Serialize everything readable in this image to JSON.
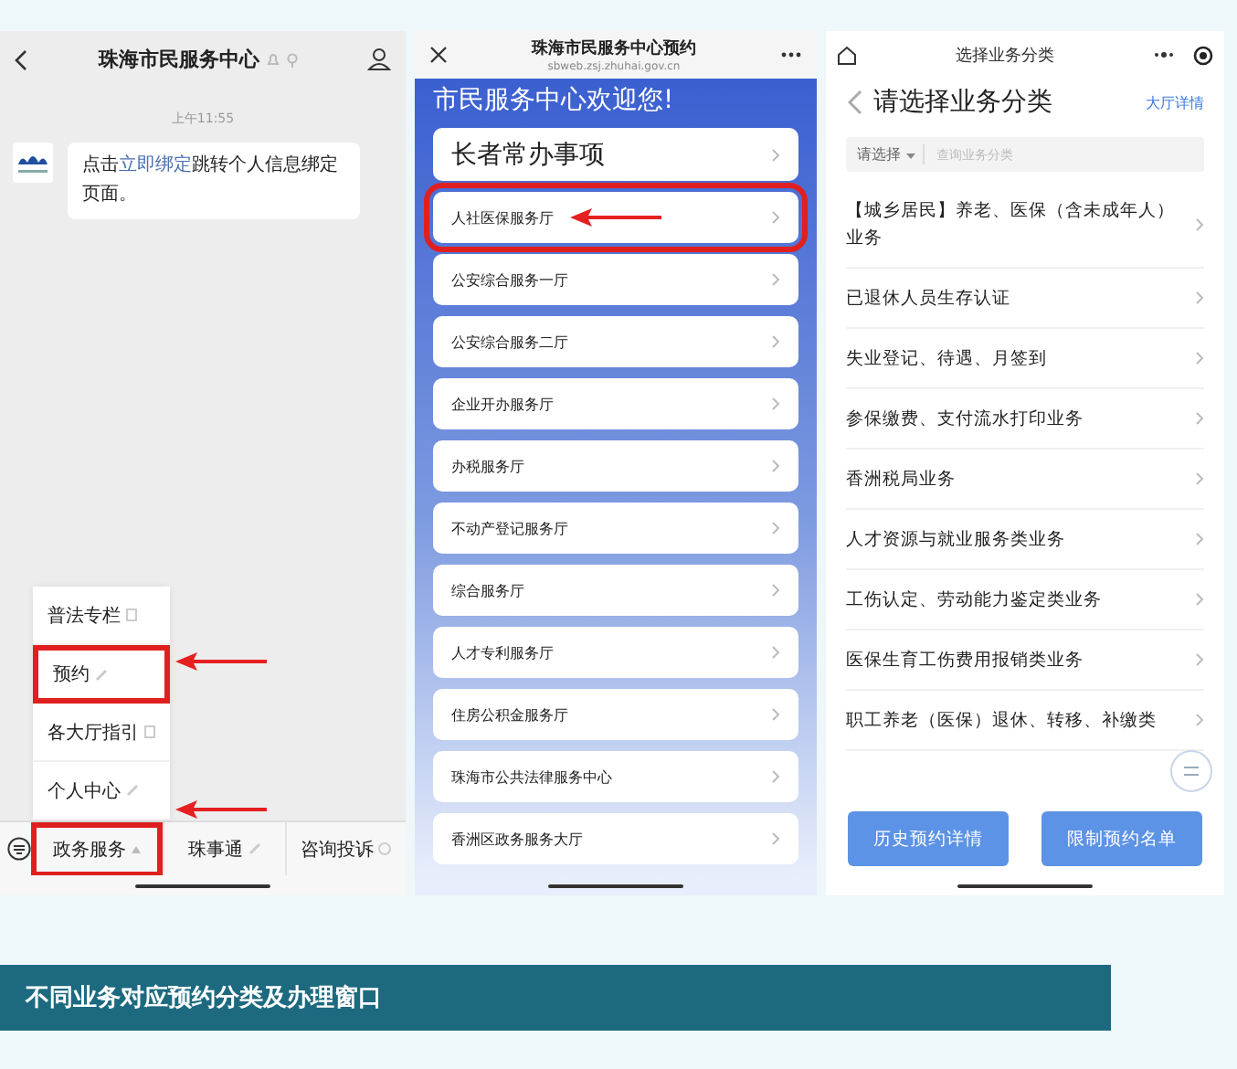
{
  "chat_screen": {
    "title": "珠海市民服务中心",
    "timestamp": "上午11:55",
    "message": {
      "text_before": "点击",
      "link": "立即绑定",
      "text_after": "跳转个人信息绑定页面。"
    },
    "menu": [
      {
        "label": "普法专栏",
        "kind": "page",
        "highlighted": false
      },
      {
        "label": "预约",
        "kind": "link",
        "highlighted": true
      },
      {
        "label": "各大厅指引",
        "kind": "page",
        "highlighted": false
      },
      {
        "label": "个人中心",
        "kind": "link",
        "highlighted": false
      }
    ],
    "bottom_tabs": [
      {
        "label": "政务服务",
        "kind": "menu",
        "highlighted": true
      },
      {
        "label": "珠事通",
        "kind": "link",
        "highlighted": false
      },
      {
        "label": "咨询投诉",
        "kind": "mini",
        "highlighted": false
      }
    ]
  },
  "booking_screen": {
    "title": "珠海市民服务中心预约",
    "url": "sbweb.zsj.zhuhai.gov.cn",
    "welcome": "市民服务中心欢迎您!",
    "halls": [
      {
        "label": "长者常办事项",
        "kind": "large",
        "highlighted": false
      },
      {
        "label": "人社医保服务厅",
        "kind": "normal",
        "highlighted": true
      },
      {
        "label": "公安综合服务一厅",
        "kind": "normal",
        "highlighted": false
      },
      {
        "label": "公安综合服务二厅",
        "kind": "normal",
        "highlighted": false
      },
      {
        "label": "企业开办服务厅",
        "kind": "normal",
        "highlighted": false
      },
      {
        "label": "办税服务厅",
        "kind": "normal",
        "highlighted": false
      },
      {
        "label": "不动产登记服务厅",
        "kind": "normal",
        "highlighted": false
      },
      {
        "label": "综合服务厅",
        "kind": "normal",
        "highlighted": false
      },
      {
        "label": "人才专利服务厅",
        "kind": "normal",
        "highlighted": false
      },
      {
        "label": "住房公积金服务厅",
        "kind": "normal",
        "highlighted": false
      },
      {
        "label": "珠海市公共法律服务中心",
        "kind": "normal",
        "highlighted": false
      },
      {
        "label": "香洲区政务服务大厅",
        "kind": "normal",
        "highlighted": false
      }
    ]
  },
  "category_screen": {
    "nav_title": "选择业务分类",
    "heading": "请选择业务分类",
    "hall_link": "大厅详情",
    "search": {
      "dropdown": "请选择",
      "placeholder": "查询业务分类"
    },
    "categories": [
      "【城乡居民】养老、医保（含未成年人）业务",
      "已退休人员生存认证",
      "失业登记、待遇、月签到",
      "参保缴费、支付流水打印业务",
      "香洲税局业务",
      "人才资源与就业服务类业务",
      "工伤认定、劳动能力鉴定类业务",
      "医保生育工伤费用报销类业务",
      "职工养老（医保）退休、转移、补缴类"
    ],
    "buttons": [
      "历史预约详情",
      "限制预约名单"
    ]
  },
  "caption": "不同业务对应预约分类及办理窗口"
}
